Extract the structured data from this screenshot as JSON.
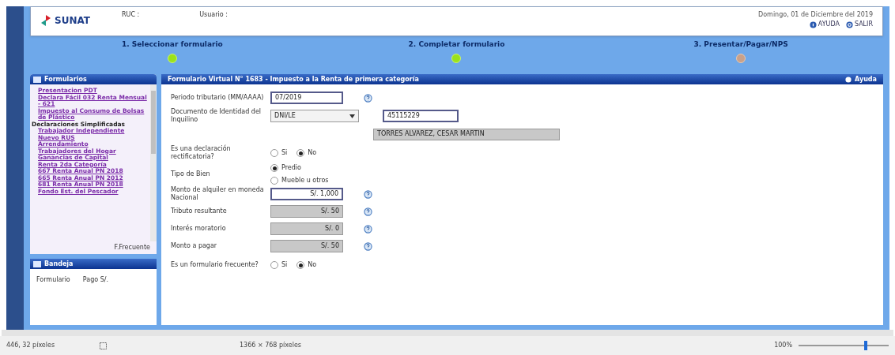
{
  "header": {
    "logo": "SUNAT",
    "ruc_label": "RUC :",
    "user_label": "Usuario :",
    "date": "Domingo, 01 de Diciembre del 2019",
    "links": [
      {
        "label": "AYUDA",
        "kind": "help"
      },
      {
        "label": "SALIR",
        "kind": "exit"
      }
    ]
  },
  "steps": [
    {
      "label": "1. Seleccionar formulario",
      "done": true
    },
    {
      "label": "2. Completar formulario",
      "done": true
    },
    {
      "label": "3. Presentar/Pagar/NPS",
      "done": false
    }
  ],
  "sidebar": {
    "title": "Formularios",
    "items": [
      {
        "label": "Presentacion PDT",
        "kind": "link"
      },
      {
        "label": "Declara Fácil 032 Renta Mensual - 621",
        "kind": "link"
      },
      {
        "label": "Impuesto al Consumo de Bolsas de Plástico",
        "kind": "link"
      },
      {
        "label": "Declaraciones Simplificadas",
        "kind": "group"
      },
      {
        "label": "Trabajador Independiente",
        "kind": "link"
      },
      {
        "label": "Nuevo RUS",
        "kind": "link"
      },
      {
        "label": "Arrendamiento",
        "kind": "link"
      },
      {
        "label": "Trabajadores del Hogar",
        "kind": "link"
      },
      {
        "label": "Ganancias de Capital",
        "kind": "link"
      },
      {
        "label": "Renta 2da Categoría",
        "kind": "link"
      },
      {
        "label": "667 Renta Anual PN 2018",
        "kind": "link"
      },
      {
        "label": "665 Renta Anual PN 2012",
        "kind": "link"
      },
      {
        "label": "681 Renta Anual PN 2018",
        "kind": "link"
      },
      {
        "label": "Fondo Est. del Pescador",
        "kind": "link"
      }
    ],
    "footer": "F.Frecuente"
  },
  "tray": {
    "title": "Bandeja",
    "columns": [
      "Formulario",
      "Pago S/."
    ]
  },
  "form": {
    "title": "Formulario Virtual N° 1683 - Impuesto a la Renta de primera categoría",
    "help": "Ayuda",
    "rows": [
      {
        "kind": "input",
        "label": "Periodo tributario (MM/AAAA)",
        "value": "07/2019",
        "help": true
      },
      {
        "kind": "document",
        "label": "Documento de Identidad del Inquilino",
        "type": "DNI/LE",
        "number": "45115229",
        "name": "TORRES ALVAREZ, CESAR MARTIN"
      },
      {
        "kind": "radio",
        "label": "Es una declaración rectificatoria?",
        "inline": true,
        "options": [
          {
            "label": "Si",
            "selected": false
          },
          {
            "label": "No",
            "selected": true
          }
        ]
      },
      {
        "kind": "radio",
        "label": "Tipo de Bien",
        "inline": false,
        "options": [
          {
            "label": "Predio",
            "selected": true
          },
          {
            "label": "Mueble u otros",
            "selected": false
          }
        ]
      },
      {
        "kind": "input",
        "label": "Monto de alquiler en moneda Nacional",
        "value": "S/. 1,000",
        "help": true
      },
      {
        "kind": "readonly",
        "label": "Tributo resultante",
        "value": "S/. 50",
        "help": true
      },
      {
        "kind": "readonly",
        "label": "Interés moratorio",
        "value": "S/. 0",
        "help": true
      },
      {
        "kind": "readonly",
        "label": "Monto a pagar",
        "value": "S/. 50",
        "help": true
      },
      {
        "kind": "radio",
        "label": "Es un formulario frecuente?",
        "inline": true,
        "options": [
          {
            "label": "Si",
            "selected": false
          },
          {
            "label": "No",
            "selected": true
          }
        ]
      }
    ]
  },
  "status_bar": {
    "cursor": "446, 32 píxeles",
    "size": "1366 × 768 píxeles",
    "zoom": "100%",
    "level": 0.75
  }
}
